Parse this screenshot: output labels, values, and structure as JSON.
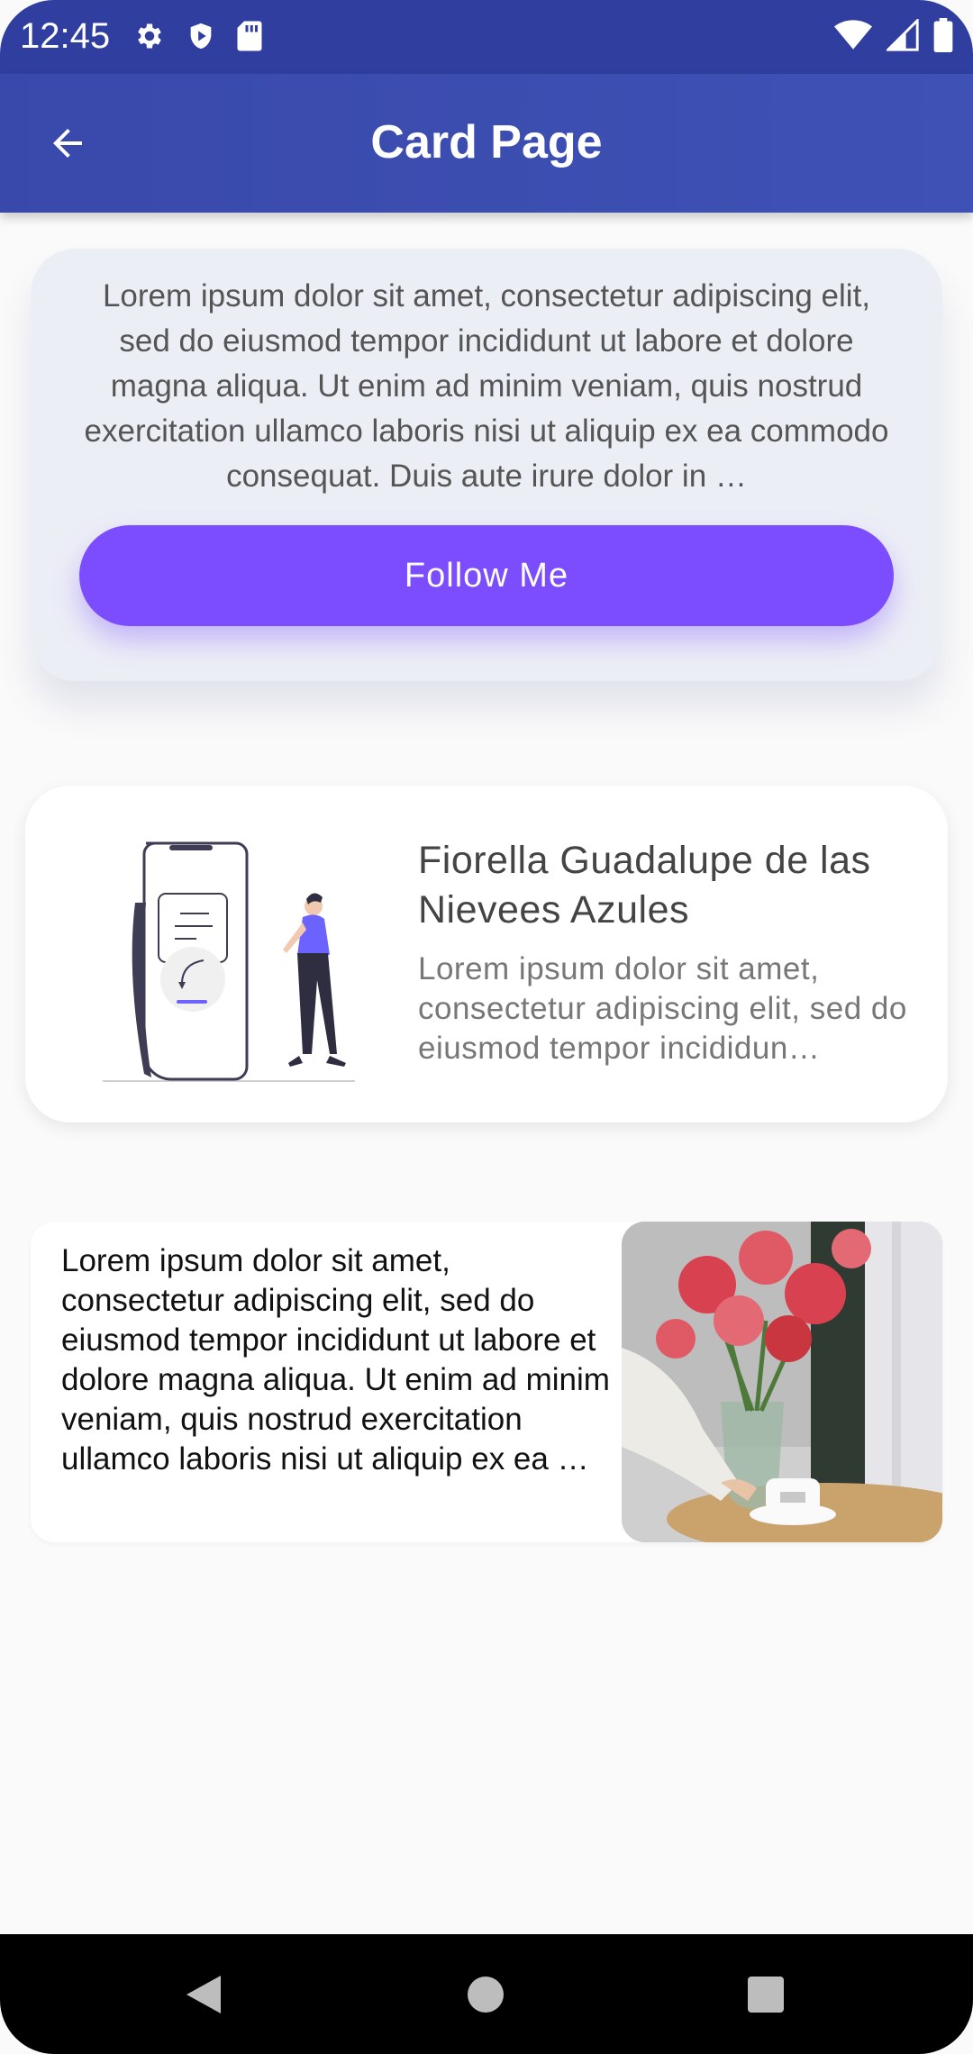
{
  "status_bar": {
    "time": "12:45",
    "icons_left": [
      "gear-icon",
      "shield-icon",
      "sd-card-icon"
    ],
    "icons_right": [
      "wifi-icon",
      "signal-icon",
      "battery-icon"
    ]
  },
  "app_bar": {
    "title": "Card Page",
    "back_icon": "arrow-back-icon"
  },
  "card1": {
    "text": "Lorem ipsum dolor sit amet, consectetur adipiscing elit, sed do eiusmod tempor incididunt ut labore et dolore magna aliqua. Ut enim ad minim veniam, quis nostrud exercitation ullamco laboris nisi ut aliquip ex ea commodo consequat. Duis aute irure dolor in …",
    "button_label": "Follow Me",
    "button_color": "#7c4dff"
  },
  "card2": {
    "title": "Fiorella Guadalupe de las Nievees Azules",
    "text": "Lorem ipsum dolor sit amet, consectetur adipiscing elit, sed do eiusmod tempor incididun…",
    "illustration": "person-with-phone-illustration"
  },
  "card3": {
    "text": "Lorem ipsum dolor sit amet, consectetur adipiscing elit, sed do eiusmod tempor incididunt ut labore et dolore magna aliqua. Ut enim ad minim veniam, quis nostrud exercitation ullamco laboris nisi ut aliquip ex ea …",
    "image": "flowers-and-coffee-photo"
  },
  "nav_bar": {
    "icons": [
      "nav-back-icon",
      "nav-home-icon",
      "nav-recents-icon"
    ]
  },
  "colors": {
    "primary": "#3f51b5",
    "status_bar": "#303f9f",
    "accent": "#7c4dff"
  }
}
